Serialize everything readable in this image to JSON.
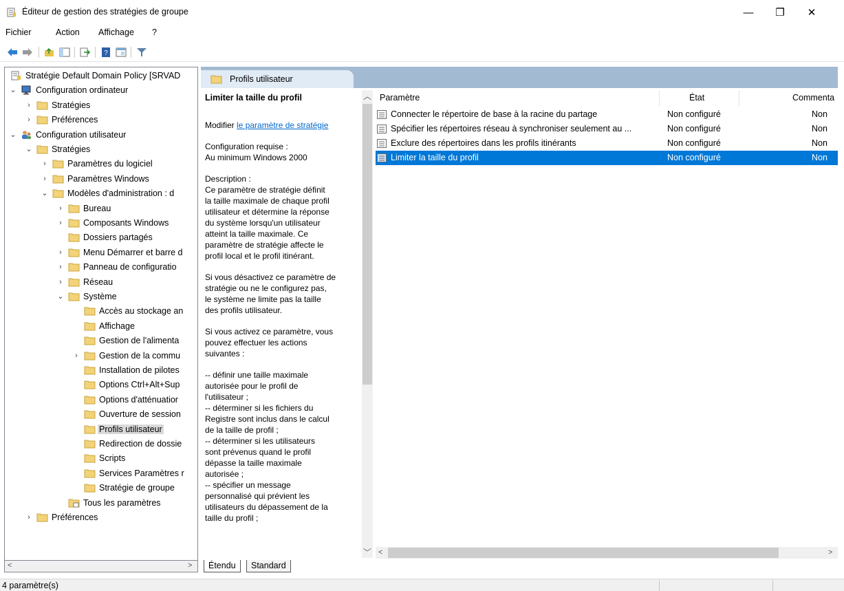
{
  "window": {
    "title": "Éditeur de gestion des stratégies de groupe",
    "minimize": "—",
    "maximize": "❐",
    "close": "✕"
  },
  "menu": [
    "Fichier",
    "Action",
    "Affichage",
    "?"
  ],
  "tree": [
    {
      "label": "Stratégie Default Domain Policy [SRVAD",
      "level": 0,
      "twisty": "",
      "icon": "policy-icon"
    },
    {
      "label": "Configuration ordinateur",
      "level": 0,
      "twisty": "down",
      "icon": "computer-icon"
    },
    {
      "label": "Stratégies",
      "level": 1,
      "twisty": "right",
      "icon": "folder-icon"
    },
    {
      "label": "Préférences",
      "level": 1,
      "twisty": "right",
      "icon": "folder-icon"
    },
    {
      "label": "Configuration utilisateur",
      "level": 0,
      "twisty": "down",
      "icon": "users-icon"
    },
    {
      "label": "Stratégies",
      "level": 1,
      "twisty": "down",
      "icon": "folder-icon"
    },
    {
      "label": "Paramètres du logiciel",
      "level": 2,
      "twisty": "right",
      "icon": "folder-icon"
    },
    {
      "label": "Paramètres Windows",
      "level": 2,
      "twisty": "right",
      "icon": "folder-icon"
    },
    {
      "label": "Modèles d'administration : d",
      "level": 2,
      "twisty": "down",
      "icon": "folder-icon"
    },
    {
      "label": "Bureau",
      "level": 3,
      "twisty": "right",
      "icon": "folder-icon"
    },
    {
      "label": "Composants Windows",
      "level": 3,
      "twisty": "right",
      "icon": "folder-icon"
    },
    {
      "label": "Dossiers partagés",
      "level": 3,
      "twisty": "",
      "icon": "folder-icon"
    },
    {
      "label": "Menu Démarrer et barre d",
      "level": 3,
      "twisty": "right",
      "icon": "folder-icon"
    },
    {
      "label": "Panneau de configuratio",
      "level": 3,
      "twisty": "right",
      "icon": "folder-icon"
    },
    {
      "label": "Réseau",
      "level": 3,
      "twisty": "right",
      "icon": "folder-icon"
    },
    {
      "label": "Système",
      "level": 3,
      "twisty": "down",
      "icon": "folder-icon"
    },
    {
      "label": "Accès au stockage an",
      "level": 4,
      "twisty": "",
      "icon": "folder-icon"
    },
    {
      "label": "Affichage",
      "level": 4,
      "twisty": "",
      "icon": "folder-icon"
    },
    {
      "label": "Gestion de l'alimenta",
      "level": 4,
      "twisty": "",
      "icon": "folder-icon"
    },
    {
      "label": "Gestion de la commu",
      "level": 4,
      "twisty": "right",
      "icon": "folder-icon"
    },
    {
      "label": "Installation de pilotes",
      "level": 4,
      "twisty": "",
      "icon": "folder-icon"
    },
    {
      "label": "Options Ctrl+Alt+Sup",
      "level": 4,
      "twisty": "",
      "icon": "folder-icon"
    },
    {
      "label": "Options d'atténuatior",
      "level": 4,
      "twisty": "",
      "icon": "folder-icon"
    },
    {
      "label": "Ouverture de session",
      "level": 4,
      "twisty": "",
      "icon": "folder-icon"
    },
    {
      "label": "Profils utilisateur",
      "level": 4,
      "twisty": "",
      "icon": "folder-icon",
      "selected": true
    },
    {
      "label": "Redirection de dossie",
      "level": 4,
      "twisty": "",
      "icon": "folder-icon"
    },
    {
      "label": "Scripts",
      "level": 4,
      "twisty": "",
      "icon": "folder-icon"
    },
    {
      "label": "Services Paramètres r",
      "level": 4,
      "twisty": "",
      "icon": "folder-icon"
    },
    {
      "label": "Stratégie de groupe",
      "level": 4,
      "twisty": "",
      "icon": "folder-icon"
    },
    {
      "label": "Tous les paramètres",
      "level": 3,
      "twisty": "",
      "icon": "all-settings-icon"
    },
    {
      "label": "Préférences",
      "level": 1,
      "twisty": "right",
      "icon": "folder-icon"
    }
  ],
  "panel": {
    "header": "Profils utilisateur",
    "description": {
      "heading": "Limiter la taille du profil",
      "modify_prefix": "Modifier ",
      "modify_link": "le paramètre de stratégie",
      "requirements": "Configuration requise :\nAu minimum Windows 2000",
      "description": "Description :\nCe paramètre de stratégie définit\nla taille maximale de chaque profil\nutilisateur et détermine la réponse\ndu système lorsqu'un utilisateur\natteint la taille maximale. Ce\nparamètre de stratégie affecte le\nprofil local et le profil itinérant.",
      "disabled": "Si vous désactivez ce paramètre de\nstratégie ou ne le configurez pas,\nle système ne limite pas la taille\ndes profils utilisateur.",
      "enabled": "Si vous activez ce paramètre, vous\npouvez effectuer les actions\nsuivantes :",
      "actions": "-- définir une taille maximale\nautorisée pour le profil de\nl'utilisateur ;\n-- déterminer si les fichiers du\nRegistre sont inclus dans le calcul\nde la taille de profil ;\n-- déterminer si les utilisateurs\nsont prévenus quand le profil\ndépasse la taille maximale\nautorisée ;\n-- spécifier un message\npersonnalisé qui prévient les\nutilisateurs du dépassement de la\ntaille du profil ;"
    },
    "columns": [
      "Paramètre",
      "État",
      "Commenta"
    ],
    "rows": [
      {
        "name": "Connecter le répertoire de base à la racine du partage",
        "state": "Non configuré",
        "comment": "Non"
      },
      {
        "name": "Spécifier les répertoires réseau à synchroniser seulement au ...",
        "state": "Non configuré",
        "comment": "Non"
      },
      {
        "name": "Exclure des répertoires dans les profils itinérants",
        "state": "Non configuré",
        "comment": "Non"
      },
      {
        "name": "Limiter la taille du profil",
        "state": "Non configuré",
        "comment": "Non",
        "selected": true
      }
    ],
    "tabs": [
      "Étendu",
      "Standard"
    ]
  },
  "status": "4 paramètre(s)",
  "colors": {
    "selection": "#0078d7",
    "header_band": "#a3bbd2",
    "folder": "#f2d37a"
  }
}
